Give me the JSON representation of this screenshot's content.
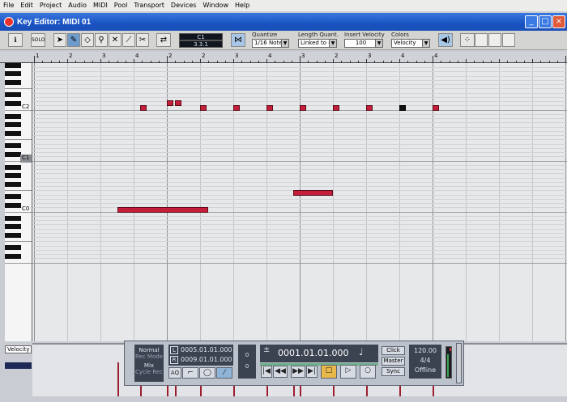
{
  "menu": [
    "File",
    "Edit",
    "Project",
    "Audio",
    "MIDI",
    "Pool",
    "Transport",
    "Devices",
    "Window",
    "Help"
  ],
  "window": {
    "title": "Key Editor: MIDI 01"
  },
  "toolbar": {
    "info_label": "i",
    "solo_label": "SOLO",
    "position_top": "C1",
    "position_bottom": "3.3.1",
    "quantize_label": "Quantize",
    "quantize_value": "1/16 Note",
    "length_label": "Length Quant.",
    "length_value": "Linked to Q",
    "velocity_label": "Insert Velocity",
    "velocity_value": "100",
    "colors_label": "Colors",
    "colors_value": "Velocity"
  },
  "ruler": {
    "labels": [
      "1",
      "2",
      "3",
      "4",
      "2",
      "2",
      "3",
      "4",
      "3",
      "2",
      "3",
      "4",
      "4"
    ]
  },
  "keyboard": {
    "labels": [
      "C2",
      "C1",
      "C0"
    ]
  },
  "notes": [
    {
      "start": 4.2,
      "len": 0.2,
      "pitch": 36
    },
    {
      "start": 5.0,
      "len": 0.2,
      "pitch": 37
    },
    {
      "start": 5.25,
      "len": 0.2,
      "pitch": 37
    },
    {
      "start": 6.0,
      "len": 0.2,
      "pitch": 36
    },
    {
      "start": 7.0,
      "len": 0.2,
      "pitch": 36
    },
    {
      "start": 8.0,
      "len": 0.2,
      "pitch": 36
    },
    {
      "start": 9.0,
      "len": 0.2,
      "pitch": 36
    },
    {
      "start": 10.0,
      "len": 0.2,
      "pitch": 36
    },
    {
      "start": 11.0,
      "len": 0.2,
      "pitch": 36
    },
    {
      "start": 12.0,
      "len": 0.2,
      "pitch": 36,
      "selected": true
    },
    {
      "start": 13.0,
      "len": 0.2,
      "pitch": 36
    },
    {
      "start": 8.8,
      "len": 1.2,
      "pitch": 16
    },
    {
      "start": 3.5,
      "len": 2.75,
      "pitch": 12
    }
  ],
  "velocity": {
    "lane_label": "Velocity"
  },
  "transport": {
    "mode_normal": "Normal",
    "mode_rec": "Rec Mode",
    "mix": "Mix",
    "cycle_rec": "Cycle Rec",
    "aq": "AQ",
    "left_marker_label": "L",
    "left_locator": "0005.01.01.000",
    "right_marker_label": "R",
    "right_locator": "0009.01.01.000",
    "counter_top": "0",
    "counter_bottom": "0",
    "position": "0001.01.01.000",
    "click": "Click",
    "master": "Master",
    "sync": "Sync",
    "tempo": "120.00",
    "signature": "4/4",
    "status": "Offline"
  }
}
